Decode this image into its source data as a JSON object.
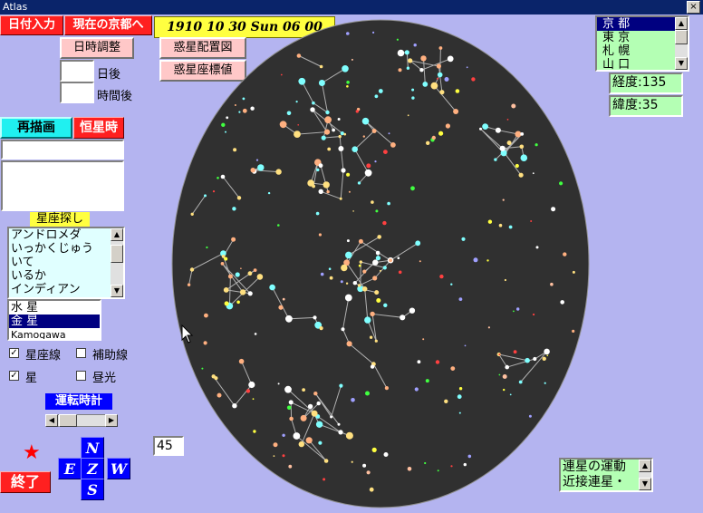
{
  "window": {
    "title": "Atlas",
    "close_glyph": "×"
  },
  "toolbar": {
    "date_input": "日付入力",
    "goto_kyoto_now": "現在の京都へ",
    "datetime_display": "1910 10 30 Sun 06 00",
    "adjust_datetime": "日時調整",
    "planet_layout": "惑星配置図",
    "planet_coords": "惑星座標値"
  },
  "offsets": {
    "days_value": "",
    "days_label": "日後",
    "hours_value": "",
    "hours_label": "時間後"
  },
  "redraw": "再描画",
  "sidereal": "恒星時",
  "info": {
    "line1": "",
    "memo": ""
  },
  "constellation_search": {
    "label": "星座探し",
    "items": [
      "アンドロメダ",
      "いっかくじゅう",
      "いて",
      "いるか",
      "インディアン"
    ]
  },
  "planets": {
    "items": [
      "水 星",
      "金 星",
      "Kamogawa"
    ],
    "selected_index": 1
  },
  "options": {
    "constellation_lines": {
      "label": "星座線",
      "checked": true
    },
    "aux_lines": {
      "label": "補助線",
      "checked": false
    },
    "stars": {
      "label": "星",
      "checked": true
    },
    "daylight": {
      "label": "昼光",
      "checked": false
    }
  },
  "rotate_clock": "運転時計",
  "speed_value": "45",
  "star_icon": "★",
  "quit": "終了",
  "compass": {
    "north": "N",
    "east": "E",
    "zenith": "Z",
    "west": "W",
    "south": "S"
  },
  "cities": {
    "items": [
      "京 都",
      "東 京",
      "札 幌",
      "山 口"
    ],
    "selected_index": 0
  },
  "longitude": "経度:135",
  "latitude": "緯度:35",
  "binary_list": {
    "items": [
      "連星の運動",
      "近接連星・"
    ]
  }
}
